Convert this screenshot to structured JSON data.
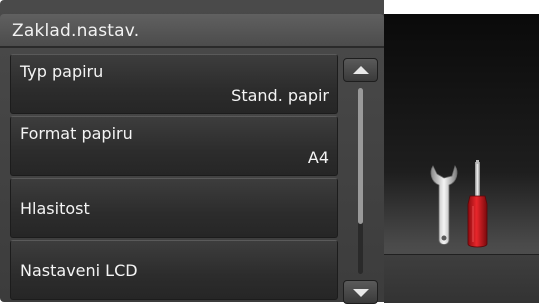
{
  "header": {
    "title": "Zaklad.nastav."
  },
  "menu": {
    "items": [
      {
        "label": "Typ papiru",
        "value": "Stand. papir"
      },
      {
        "label": "Format papiru",
        "value": "A4"
      },
      {
        "label": "Hlasitost",
        "value": ""
      },
      {
        "label": "Nastaveni LCD",
        "value": ""
      }
    ]
  },
  "scrollbar": {
    "position_fraction": 0.0,
    "visible_fraction": 0.73
  },
  "icons": {
    "scroll_up": "arrow-up-icon",
    "scroll_down": "arrow-down-icon",
    "settings": "wrench-screwdriver-icon"
  },
  "colors": {
    "panel": "#3c3c3c",
    "text": "#f4f4f4",
    "screwdriver_handle": "#d8171c"
  }
}
